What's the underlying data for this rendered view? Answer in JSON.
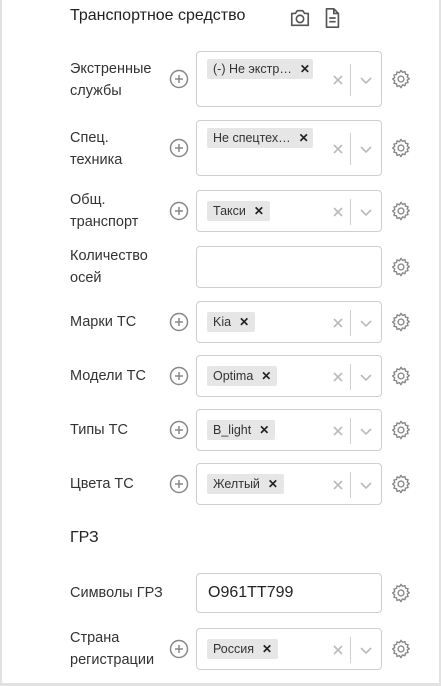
{
  "vehicle_section": {
    "title": "Транспортное средство",
    "icons": [
      "camera-icon",
      "document-icon"
    ]
  },
  "fields": [
    {
      "label": "Экстренные службы",
      "chip": "(-) Не экстр…"
    },
    {
      "label": "Спец. техника",
      "chip": "Не спецтех…"
    },
    {
      "label": "Общ. транспорт",
      "chip": "Такси"
    },
    {
      "label": "Количество осей",
      "value": ""
    },
    {
      "label": "Марки ТС",
      "chip": "Kia"
    },
    {
      "label": "Модели ТС",
      "chip": "Optima"
    },
    {
      "label": "Типы ТС",
      "chip": "B_light"
    },
    {
      "label": "Цвета ТС",
      "chip": "Желтый"
    }
  ],
  "grz_section": {
    "title": "ГРЗ",
    "symbols": {
      "label": "Символы ГРЗ",
      "value": "О961ТТ799"
    },
    "country": {
      "label": "Страна регистрации",
      "chip": "Россия"
    }
  },
  "colors": {
    "chip_bg": "#e6e6e6",
    "border": "#cfcfcf",
    "icon": "#8a8a8a"
  }
}
